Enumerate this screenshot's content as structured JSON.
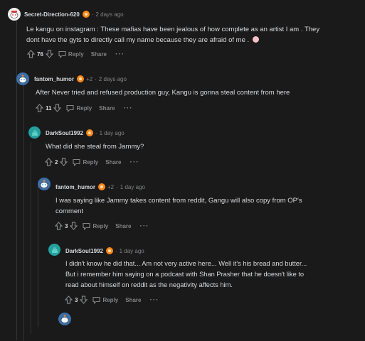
{
  "comments": [
    {
      "author": "Secret-Direction-620",
      "time": "2 days ago",
      "body": [
        "Le kangu on instagram : These mafias have been jealous of how complete as an artist I am . They",
        "dont have the gyts to directly call my name because they are afraid of me ."
      ],
      "votes": "76",
      "reply_label": "Reply",
      "share_label": "Share",
      "more_label": "···"
    },
    {
      "author": "fantom_humor",
      "flair_extra": "+2",
      "time": "2 days ago",
      "body": [
        "After Never tried and refused production guy, Kangu is gonna steal content from here"
      ],
      "votes": "11",
      "reply_label": "Reply",
      "share_label": "Share",
      "more_label": "···"
    },
    {
      "author": "DarkSoul1992",
      "time": "1 day ago",
      "body": [
        "What did she steal from Jammy?"
      ],
      "votes": "2",
      "reply_label": "Reply",
      "share_label": "Share",
      "more_label": "···"
    },
    {
      "author": "fantom_humor",
      "flair_extra": "+2",
      "time": "1 day ago",
      "body": [
        "I was saying like Jammy takes content from reddit, Gangu will also copy from OP's",
        "comment"
      ],
      "votes": "3",
      "reply_label": "Reply",
      "share_label": "Share",
      "more_label": "···"
    },
    {
      "author": "DarkSoul1992",
      "time": "1 day ago",
      "body": [
        "I didn't know he did that... Am not very active here... Well it's his bread and butter...",
        "But i remember him saying on a podcast with Shan Prasher that he doesn't like to",
        "read about himself on reddit as the negativity affects him."
      ],
      "votes": "3",
      "reply_label": "Reply",
      "share_label": "Share",
      "more_label": "···"
    }
  ],
  "separator": "·",
  "colors": {
    "background": "#1a1a1b",
    "text": "#d7dadc",
    "muted": "#818384",
    "thread_line": "#343536",
    "badge_orange": "#ff8717",
    "avatar_teal": "#24a0a0"
  }
}
